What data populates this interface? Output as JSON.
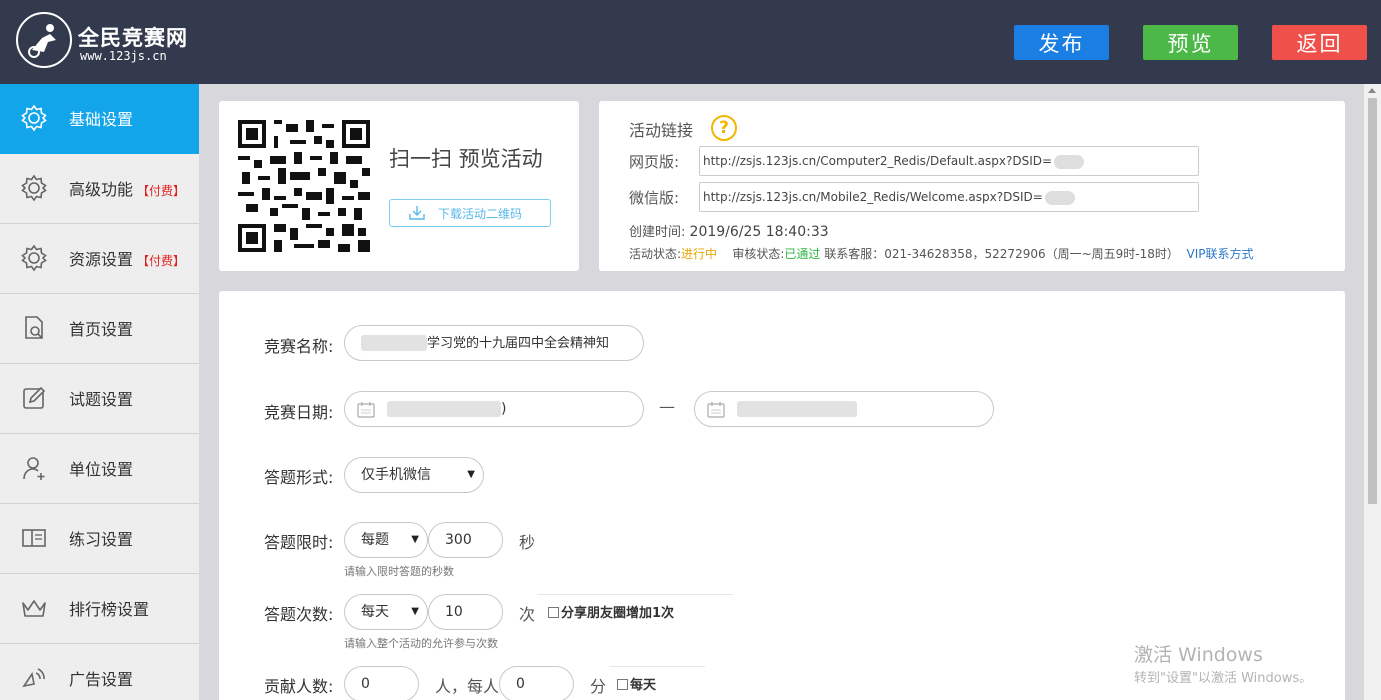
{
  "header": {
    "logo_title": "全民竞赛网",
    "logo_url": "www.123js.cn",
    "publish_label": "发布",
    "preview_label": "预览",
    "back_label": "返回",
    "colors": {
      "bg": "#343a4e",
      "publish": "#1a7ee2",
      "preview": "#4cb848",
      "back": "#f0504a"
    }
  },
  "sidebar": {
    "active_color": "#13a5ea",
    "items": [
      {
        "label": "基础设置",
        "paid": "",
        "icon": "gear-icon",
        "active": true
      },
      {
        "label": "高级功能",
        "paid": "【付费】",
        "icon": "gear-icon"
      },
      {
        "label": "资源设置",
        "paid": "【付费】",
        "icon": "gear-icon"
      },
      {
        "label": "首页设置",
        "paid": "",
        "icon": "page-search-icon"
      },
      {
        "label": "试题设置",
        "paid": "",
        "icon": "edit-icon"
      },
      {
        "label": "单位设置",
        "paid": "",
        "icon": "user-add-icon"
      },
      {
        "label": "练习设置",
        "paid": "",
        "icon": "book-icon"
      },
      {
        "label": "排行榜设置",
        "paid": "",
        "icon": "crown-icon"
      },
      {
        "label": "广告设置",
        "paid": "",
        "icon": "broadcast-icon"
      }
    ]
  },
  "qr_card": {
    "scan_text": "扫一扫 预览活动",
    "download_label": "下载活动二维码"
  },
  "link_card": {
    "title": "活动链接",
    "help_symbol": "?",
    "web_label": "网页版:",
    "web_url": "http://zsjs.123js.cn/Computer2_Redis/Default.aspx?DSID=",
    "wechat_label": "微信版:",
    "wechat_url": "http://zsjs.123js.cn/Mobile2_Redis/Welcome.aspx?DSID=",
    "created_label": "创建时间:",
    "created_value": "2019/6/25 18:40:33",
    "status_label": "活动状态:",
    "status_value": "进行中",
    "review_label": "审核状态:",
    "review_value": "已通过",
    "contact_text": "联系客服：021-34628358，52272906（周一~周五9时-18时）",
    "vip_link": "VIP联系方式"
  },
  "form": {
    "name_label": "竞赛名称:",
    "name_value": "学习党的十九届四中全会精神知",
    "date_label": "竞赛日期:",
    "date_end_suffix": ")",
    "date_separator": "—",
    "mode_label": "答题形式:",
    "mode_value": "仅手机微信",
    "time_label": "答题限时:",
    "time_unit_select": "每题",
    "time_value": "300",
    "time_unit": "秒",
    "time_hint": "请输入限时答题的秒数",
    "count_label": "答题次数:",
    "count_unit_select": "每天",
    "count_value": "10",
    "count_unit": "次",
    "share_check": "分享朋友圈增加1次",
    "count_hint": "请输入整个活动的允许参与次数",
    "contrib_label": "贡献人数:",
    "contrib_value": "0",
    "contrib_unit": "人，每人",
    "points_value": "0",
    "points_unit": "分",
    "daily_check": "每天"
  },
  "watermark": {
    "title": "激活 Windows",
    "subtitle": "转到\"设置\"以激活 Windows。"
  }
}
